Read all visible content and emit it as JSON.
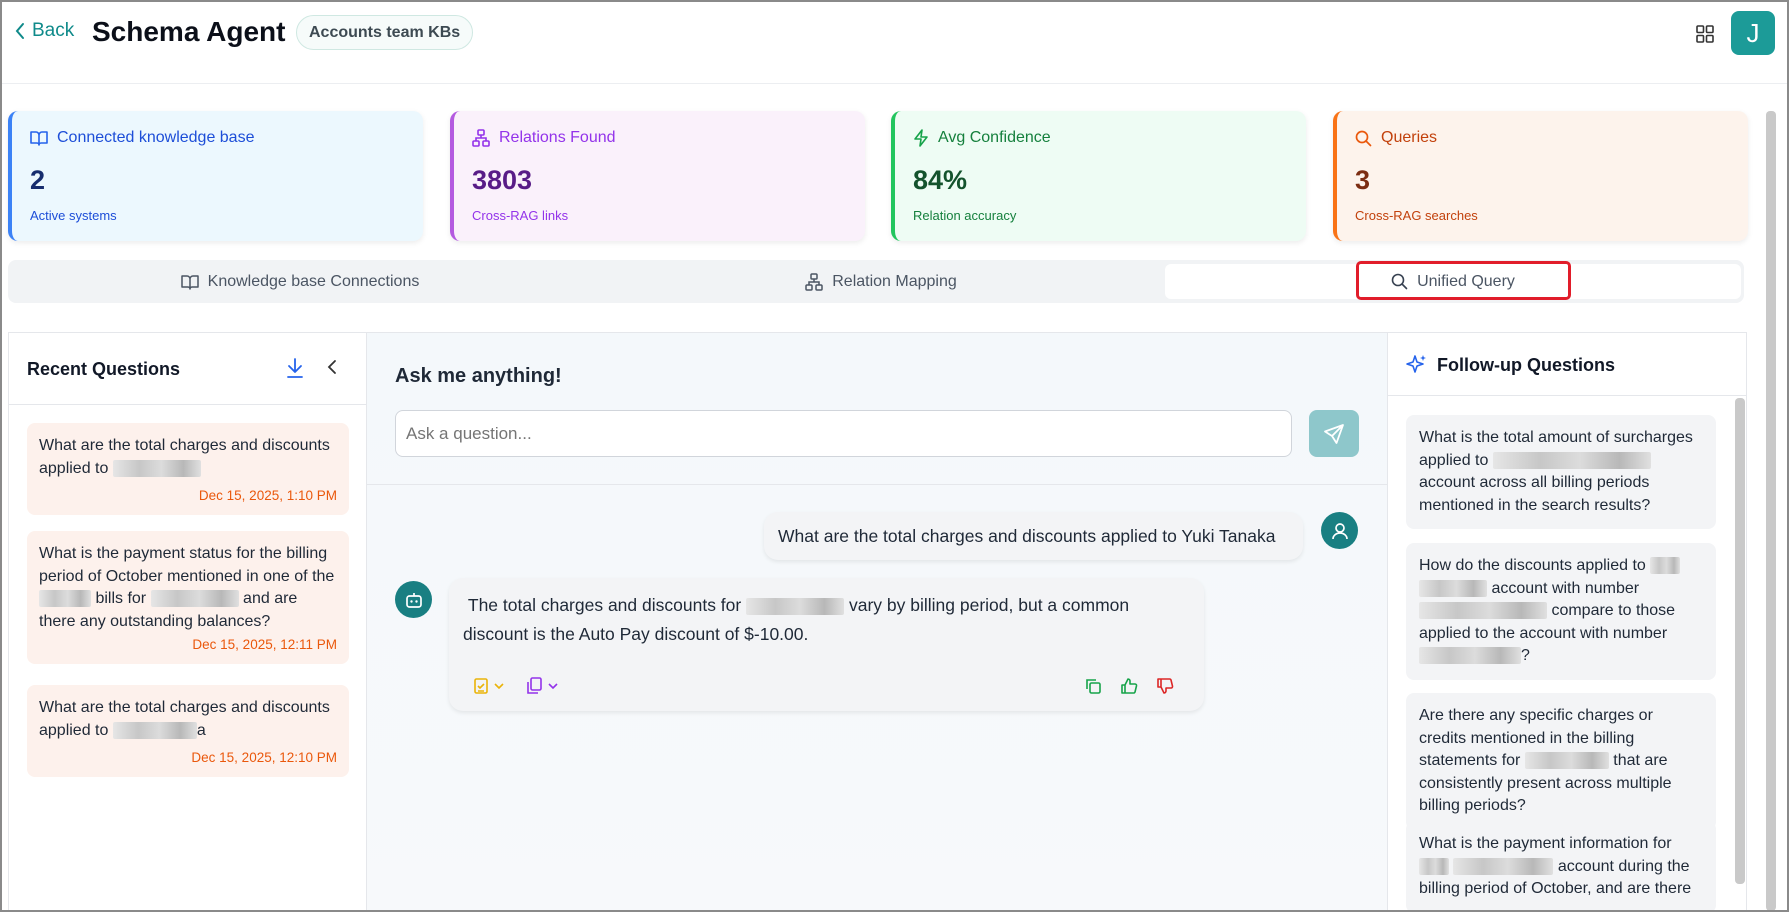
{
  "header": {
    "back_label": "Back",
    "title": "Schema Agent",
    "kb_pill": "Accounts team KBs",
    "avatar_letter": "J"
  },
  "stats": [
    {
      "label": "Connected knowledge base",
      "value": "2",
      "sub": "Active systems",
      "icon": "book-icon"
    },
    {
      "label": "Relations Found",
      "value": "3803",
      "sub": "Cross-RAG links",
      "icon": "network-icon"
    },
    {
      "label": "Avg Confidence",
      "value": "84%",
      "sub": "Relation accuracy",
      "icon": "bolt-icon"
    },
    {
      "label": "Queries",
      "value": "3",
      "sub": "Cross-RAG searches",
      "icon": "search-icon"
    }
  ],
  "tabs": [
    {
      "label": "Knowledge base Connections",
      "icon": "book-icon"
    },
    {
      "label": "Relation Mapping",
      "icon": "network-icon"
    },
    {
      "label": "Unified Query",
      "icon": "search-icon",
      "active": true
    }
  ],
  "recent": {
    "title": "Recent Questions",
    "items": [
      {
        "text_a": "What are the total charges and discounts applied to",
        "text_b": "",
        "date": "Dec 15, 2025, 1:10 PM"
      },
      {
        "text_a": "What is the payment status for the billing period of October mentioned in one of the",
        "text_b": "bills for",
        "text_c": "and are there any outstanding balances?",
        "date": "Dec 15, 2025, 12:11 PM"
      },
      {
        "text_a": "What are the total charges and discounts applied to",
        "text_b": "a",
        "date": "Dec 15, 2025, 12:10 PM"
      }
    ]
  },
  "chat": {
    "title": "Ask me anything!",
    "placeholder": "Ask a question...",
    "user_message": "What are the total charges and discounts applied to Yuki Tanaka",
    "bot_message_a": "The total charges and discounts for",
    "bot_message_b": "vary by billing period, but a common discount is the Auto Pay discount of $-10.00."
  },
  "followup": {
    "title": "Follow-up Questions",
    "items": [
      {
        "a": "What is the total amount of surcharges applied to",
        "b": "account across all billing periods mentioned in the search results?"
      },
      {
        "a": "How do the discounts applied to",
        "b": "account with number",
        "c": "compare to those applied to the account with number",
        "d": "?"
      },
      {
        "a": "Are there any specific charges or credits mentioned in the billing statements for",
        "b": "that are consistently present across multiple billing periods?"
      },
      {
        "a": "What is the payment information for",
        "b": "account during the billing period of October, and are there"
      }
    ]
  },
  "colors": {
    "accent": "#1c9b98",
    "highlight": "#e11d2a"
  }
}
